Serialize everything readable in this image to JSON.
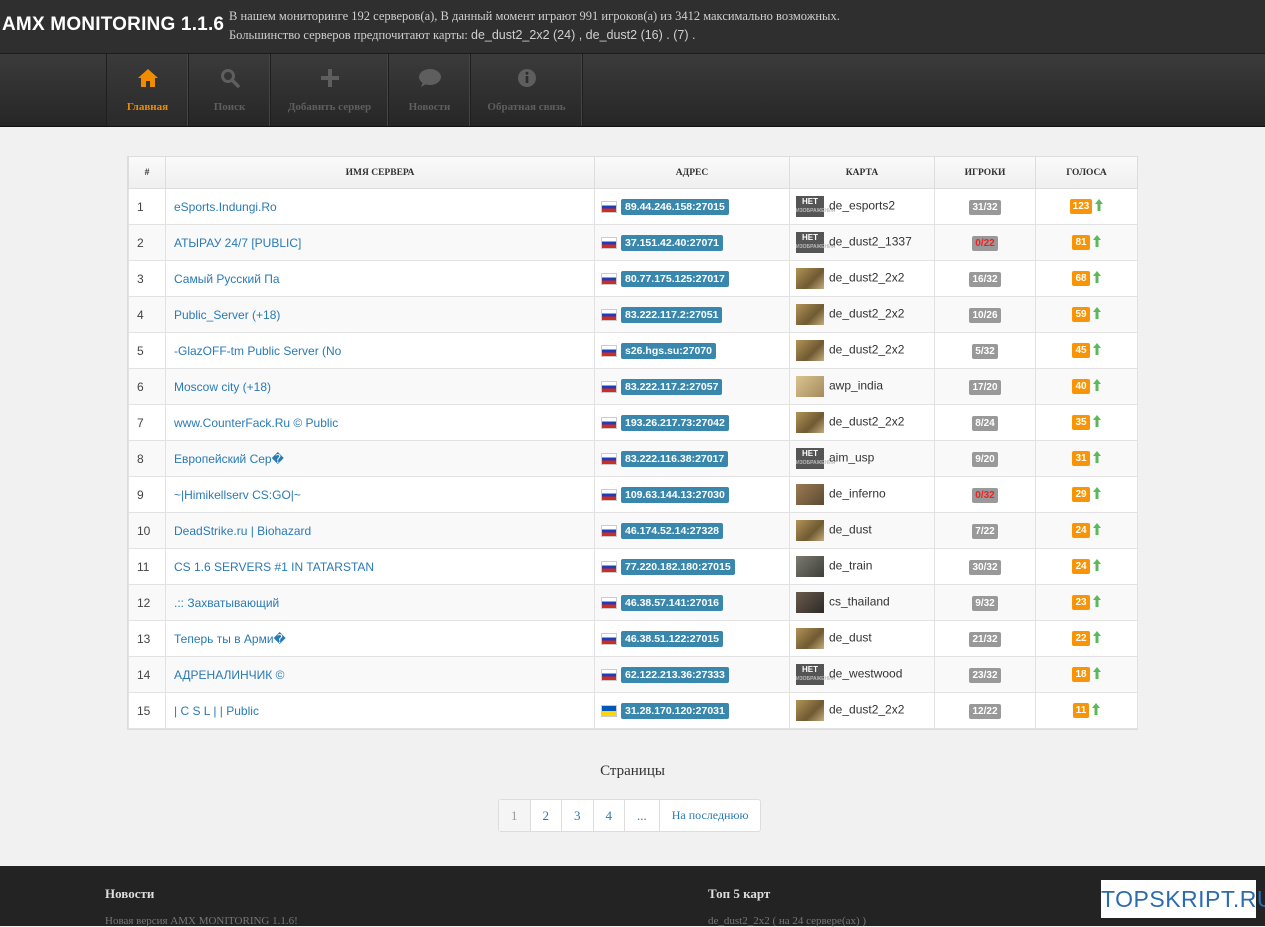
{
  "header": {
    "brand": "AMX MONITORING 1.1.6",
    "info_prefix": "В нашем мониторинге 192 серверов(а), В данный момент играют 991 игроков(а) из 3412 максимально возможных.",
    "maps_prefix": "Большинство серверов предпочитают карты:",
    "maps_value": "de_dust2_2x2 (24) , de_dust2 (16) . (7) ."
  },
  "nav": [
    {
      "label": "Главная",
      "icon": "home-icon",
      "active": true
    },
    {
      "label": "Поиск",
      "icon": "search-icon"
    },
    {
      "label": "Добавить сервер",
      "icon": "plus-icon"
    },
    {
      "label": "Новости",
      "icon": "chat-bubble-icon"
    },
    {
      "label": "Обратная связь",
      "icon": "info-icon"
    }
  ],
  "table": {
    "headers": [
      "#",
      "ИМЯ СЕРВЕРА",
      "АДРЕС",
      "КАРТА",
      "ИГРОКИ",
      "ГОЛОСА"
    ],
    "rows": [
      {
        "n": "1",
        "name": "eSports.Indungi.Ro",
        "addr": "89.44.246.158:27015",
        "flag": "ru",
        "map": "de_esports2",
        "thumb": "net",
        "players": "31/32",
        "empty": false,
        "votes": "123"
      },
      {
        "n": "2",
        "name": "АТЫРАУ 24/7 [PUBLIC]",
        "addr": "37.151.42.40:27071",
        "flag": "ru",
        "map": "de_dust2_1337",
        "thumb": "net",
        "players": "0/22",
        "empty": true,
        "votes": "81"
      },
      {
        "n": "3",
        "name": "Самый Русский Па",
        "addr": "80.77.175.125:27017",
        "flag": "ru",
        "map": "de_dust2_2x2",
        "thumb": "dust",
        "players": "16/32",
        "empty": false,
        "votes": "68"
      },
      {
        "n": "4",
        "name": "Public_Server (+18)",
        "addr": "83.222.117.2:27051",
        "flag": "ru",
        "map": "de_dust2_2x2",
        "thumb": "dust",
        "players": "10/26",
        "empty": false,
        "votes": "59"
      },
      {
        "n": "5",
        "name": "-GlazOFF-tm Public Server (No",
        "addr": "s26.hgs.su:27070",
        "flag": "ru",
        "map": "de_dust2_2x2",
        "thumb": "dust",
        "players": "5/32",
        "empty": false,
        "votes": "45"
      },
      {
        "n": "6",
        "name": "Moscow city (+18)",
        "addr": "83.222.117.2:27057",
        "flag": "ru",
        "map": "awp_india",
        "thumb": "awp",
        "players": "17/20",
        "empty": false,
        "votes": "40"
      },
      {
        "n": "7",
        "name": "www.CounterFack.Ru © Public",
        "addr": "193.26.217.73:27042",
        "flag": "ru",
        "map": "de_dust2_2x2",
        "thumb": "dust",
        "players": "8/24",
        "empty": false,
        "votes": "35"
      },
      {
        "n": "8",
        "name": "Европейский Сер�",
        "addr": "83.222.116.38:27017",
        "flag": "ru",
        "map": "aim_usp",
        "thumb": "net",
        "players": "9/20",
        "empty": false,
        "votes": "31"
      },
      {
        "n": "9",
        "name": "~|Himikellserv CS:GO|~",
        "addr": "109.63.144.13:27030",
        "flag": "ru",
        "map": "de_inferno",
        "thumb": "inferno",
        "players": "0/32",
        "empty": true,
        "votes": "29"
      },
      {
        "n": "10",
        "name": "DeadStrike.ru | Biohazard",
        "addr": "46.174.52.14:27328",
        "flag": "ru",
        "map": "de_dust",
        "thumb": "dust",
        "players": "7/22",
        "empty": false,
        "votes": "24"
      },
      {
        "n": "11",
        "name": "CS 1.6 SERVERS #1 IN TATARSTAN",
        "addr": "77.220.182.180:27015",
        "flag": "ru",
        "map": "de_train",
        "thumb": "train",
        "players": "30/32",
        "empty": false,
        "votes": "24"
      },
      {
        "n": "12",
        "name": ".:: Захватывающий",
        "addr": "46.38.57.141:27016",
        "flag": "ru",
        "map": "cs_thailand",
        "thumb": "thai",
        "players": "9/32",
        "empty": false,
        "votes": "23"
      },
      {
        "n": "13",
        "name": "Теперь ты в Арми�",
        "addr": "46.38.51.122:27015",
        "flag": "ru",
        "map": "de_dust",
        "thumb": "dust",
        "players": "21/32",
        "empty": false,
        "votes": "22"
      },
      {
        "n": "14",
        "name": "АДРЕНАЛИНЧИК ©",
        "addr": "62.122.213.36:27333",
        "flag": "ru",
        "map": "de_westwood",
        "thumb": "net",
        "players": "23/32",
        "empty": false,
        "votes": "18"
      },
      {
        "n": "15",
        "name": "|      C      S      L      | | Public",
        "addr": "31.28.170.120:27031",
        "flag": "ua",
        "map": "de_dust2_2x2",
        "thumb": "dust",
        "players": "12/22",
        "empty": false,
        "votes": "11"
      }
    ]
  },
  "thumb_text": {
    "net_big": "НЕТ",
    "net_small": "ИЗОБРАЖЕНИЯ"
  },
  "pagination": {
    "title": "Страницы",
    "pages": [
      "1",
      "2",
      "3",
      "4",
      "..."
    ],
    "last_label": "На последнюю",
    "current": "1"
  },
  "footer": {
    "news_title": "Новости",
    "news_text": "Новая версия AMX MONITORING 1.1.6!",
    "top_maps_title": "Топ 5 карт",
    "top_maps_text": "de_dust2_2x2 ( на 24 сервере(ах) )"
  },
  "watermark": "TOPSKRIPT.RU",
  "colors": {
    "accent_orange": "#f08c00",
    "link_blue": "#2a7ab5",
    "ip_badge": "#3a87ad",
    "votes_badge": "#f89406",
    "players_badge": "#999999",
    "empty_players_text": "#ee2222"
  }
}
